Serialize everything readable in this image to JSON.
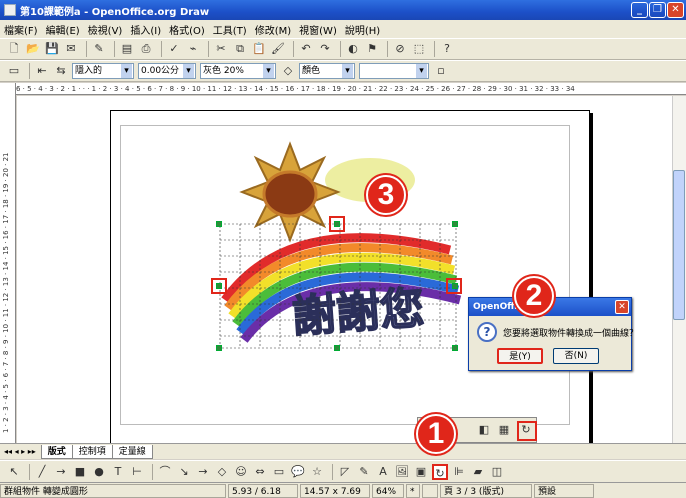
{
  "window": {
    "title": "第10課範例a - OpenOffice.org Draw"
  },
  "menu": [
    "檔案(F)",
    "編輯(E)",
    "檢視(V)",
    "插入(I)",
    "格式(O)",
    "工具(T)",
    "修改(M)",
    "視窗(W)",
    "說明(H)"
  ],
  "format_bar": {
    "line_style": "隱入的",
    "line_width": "0.00公分",
    "area_color": "灰色 20%",
    "area_fill": "顏色"
  },
  "ruler": {
    "horizontal": "6 · 5 · 4 · 3 · 2 · 1 · · · 1 · 2 · 3 · 4 · 5 · 6 · 7 · 8 · 9 · 10 · 11 · 12 · 13 · 14 · 15 · 16 · 17 · 18 · 19 · 20 · 21 · 22 · 23 · 24 · 25 · 26 · 27 · 28 · 29 · 30 · 31 · 32 · 33 · 34",
    "vertical": "1 · 2 · 3 · 4 · 5 · 6 · 7 · 8 · 9 · 10 · 11 · 12 · 13 · 14 · 15 · 16 · 17 · 18 · 19 · 20 · 21"
  },
  "artwork": {
    "text": "謝謝您"
  },
  "tabs": [
    "版式",
    "控制項",
    "定量線"
  ],
  "dialog": {
    "title": "OpenOffice.org",
    "message": "您要將選取物件轉換成一個曲線？",
    "yes": "是(Y)",
    "no": "否(N)"
  },
  "markers": {
    "one": "1",
    "two": "2",
    "three": "3"
  },
  "status": {
    "message": "群組物件 轉變成圓形",
    "position": "5.93 / 6.18",
    "size": "14.57 x 7.69",
    "zoom": "64%",
    "star": "*",
    "page": "頁 3 / 3 (版式)",
    "layout": "預設"
  },
  "colors": {
    "marker_red": "#e0261a",
    "titlebar_blue": "#1c50c8"
  }
}
